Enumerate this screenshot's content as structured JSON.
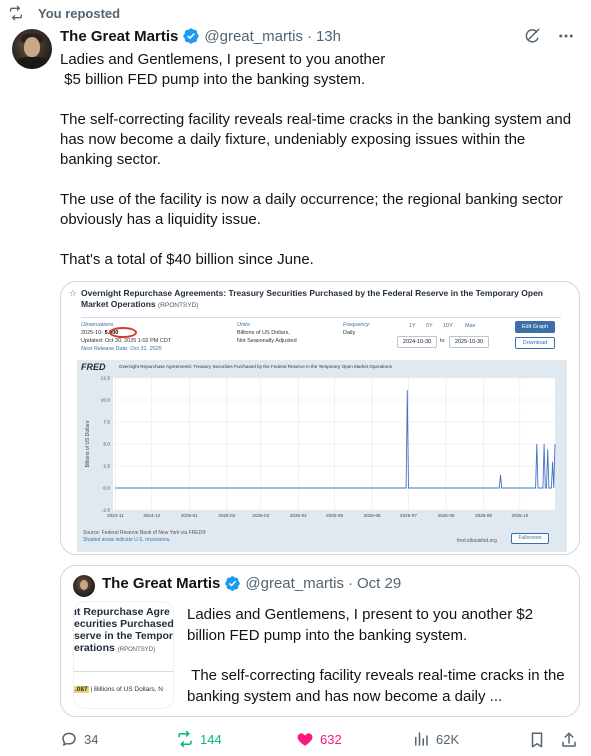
{
  "repost": {
    "label": "You reposted",
    "icon": "repost-icon"
  },
  "tweet": {
    "author": {
      "name": "The Great Martis",
      "handle": "@great_martis",
      "separator": "·",
      "time": "13h"
    },
    "paragraphs": [
      "Ladies and Gentlemens, I present to you another\n $5 billion FED pump into the banking system.",
      "The self-correcting facility reveals real-time cracks in the banking system and has now become a daily fixture, undeniably exposing issues within the banking sector.",
      "The use of the facility is now a daily occurrence; the regional banking sector obviously has a liquidity issue.",
      "That's a total of $40 billion since June."
    ]
  },
  "fred": {
    "title": "Overnight Repurchase Agreements: Treasury Securities Purchased by the Federal Reserve in the Temporary Open Market Operations",
    "series_id": "(RPONTSYD)",
    "observations_label": "Observations",
    "observation_date": "2025-10-",
    "observation_value": "5.000",
    "updated": "Updated: Oct 30, 2025 1:02 PM CDT",
    "next_release": "Next Release Date: Oct 31, 2025",
    "units_label": "Units:",
    "units_value_1": "Billions of US Dollars,",
    "units_value_2": "Not Seasonally Adjusted",
    "frequency_label": "Frequency:",
    "frequency_value": "Daily",
    "ranges": [
      "1Y",
      "5Y",
      "10Y",
      "Max"
    ],
    "date_from": "2024-10-30",
    "date_to": "2025-10-30",
    "to_label": "to",
    "edit_graph": "Edit Graph",
    "download": "Download",
    "logo": "FRED",
    "chart_heading": "Overnight Repurchase Agreements: Treasury Securities Purchased by the Federal Reserve in the Temporary Open Market Operations",
    "source": "Source: Federal Reserve Bank of New York via FRED®",
    "shaded": "Shaded areas indicate U.S. recessions.",
    "url": "fred.stlouisfed.org",
    "fullscreen": "Fullscreen"
  },
  "chart_data": {
    "type": "line",
    "title": "Overnight Repurchase Agreements: Treasury Securities Purchased by the Federal Reserve in the Temporary Open Market Operations",
    "ylabel": "Billions of US Dollars",
    "xlabel": "",
    "ylim": [
      -2.5,
      12.5
    ],
    "yticks": [
      "12.5",
      "10.0",
      "7.5",
      "5.0",
      "2.5",
      "0.0",
      "-2.5"
    ],
    "xticks": [
      "2024-11",
      "2024-12",
      "2025-01",
      "2025-02",
      "2025-03",
      "2025-04",
      "2025-05",
      "2025-06",
      "2025-07",
      "2025-08",
      "2025-09",
      "2025-10"
    ],
    "series": [
      {
        "color": "#4572c4",
        "points": [
          [
            "2024-11-01",
            0.0
          ],
          [
            "2025-06-29",
            0.0
          ],
          [
            "2025-06-30",
            11.1
          ],
          [
            "2025-07-01",
            0.0
          ],
          [
            "2025-09-14",
            0.0
          ],
          [
            "2025-09-15",
            1.5
          ],
          [
            "2025-09-16",
            0.0
          ],
          [
            "2025-09-29",
            0.0
          ],
          [
            "2025-09-30",
            0.0
          ],
          [
            "2025-10-14",
            0.0
          ],
          [
            "2025-10-15",
            5.0
          ],
          [
            "2025-10-16",
            0.0
          ],
          [
            "2025-10-20",
            0.0
          ],
          [
            "2025-10-21",
            5.0
          ],
          [
            "2025-10-22",
            0.0
          ],
          [
            "2025-10-23",
            0.0
          ],
          [
            "2025-10-24",
            4.4
          ],
          [
            "2025-10-25",
            0.0
          ],
          [
            "2025-10-27",
            0.0
          ],
          [
            "2025-10-28",
            3.0
          ],
          [
            "2025-10-29",
            0.0
          ],
          [
            "2025-10-30",
            5.0
          ]
        ]
      }
    ]
  },
  "quote": {
    "author": {
      "name": "The Great Martis",
      "handle": "@great_martis",
      "separator": "·",
      "time": "Oct 29"
    },
    "thumb_lines": [
      "ıt Repurchase Agre",
      "ecurities Purchased",
      "serve in the Tempora",
      "erations"
    ],
    "thumb_series": "(RPONTSYD)",
    "thumb_value": ".087",
    "thumb_units": "| Billions of US Dollars, N",
    "paragraphs": [
      "Ladies and Gentlemens, I present to you another $2 billion FED pump into the banking system.",
      " The self-correcting facility reveals real-time cracks in the banking system and has now become a daily ..."
    ]
  },
  "actions": {
    "replies": "34",
    "reposts": "144",
    "likes": "632",
    "views": "62K"
  }
}
